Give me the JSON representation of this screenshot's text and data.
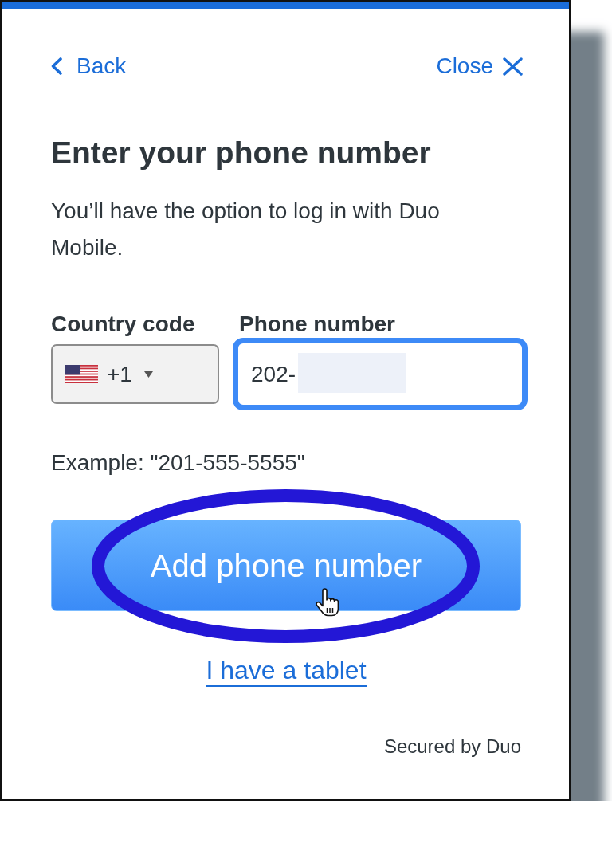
{
  "header": {
    "back_link": "Back",
    "close_link": "Close"
  },
  "title": "Enter your phone number",
  "description": "You’ll have the option to log in with Duo Mobile.",
  "country_code": {
    "label": "Country code",
    "value": "+1"
  },
  "phone_number": {
    "label": "Phone number",
    "value": "202-",
    "focused": true
  },
  "example_hint": "Example: \"201-555-5555\"",
  "submit_button": "Add phone number",
  "tablet_link": "I have a tablet",
  "footer": "Secured by Duo"
}
